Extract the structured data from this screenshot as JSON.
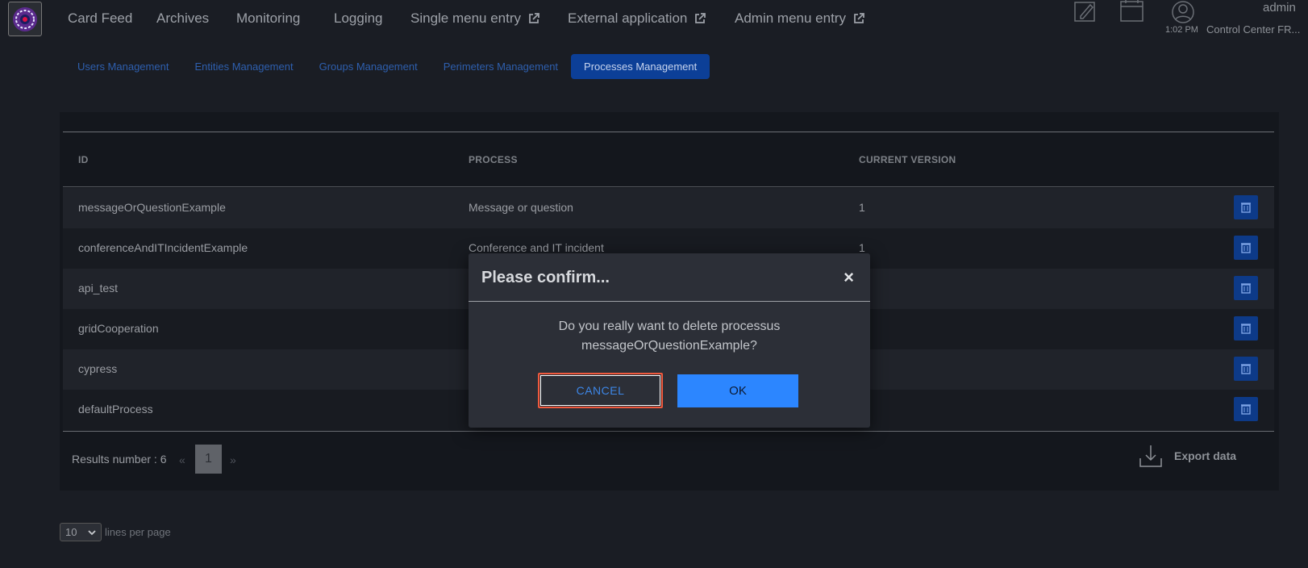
{
  "header": {
    "nav": [
      "Card Feed",
      "Archives",
      "Monitoring",
      "Logging",
      "Single menu entry",
      "External application",
      "Admin menu entry"
    ],
    "clock": "1:02 PM",
    "user": "admin",
    "center": "Control Center FR..."
  },
  "subnav": {
    "tabs": [
      "Users Management",
      "Entities Management",
      "Groups Management",
      "Perimeters Management",
      "Processes Management"
    ],
    "active": "Processes Management"
  },
  "table": {
    "columns": [
      "ID",
      "PROCESS",
      "CURRENT VERSION"
    ],
    "rows": [
      {
        "id": "messageOrQuestionExample",
        "process": "Message or question",
        "version": "1"
      },
      {
        "id": "conferenceAndITIncidentExample",
        "process": "Conference and IT incident",
        "version": "1"
      },
      {
        "id": "api_test",
        "process": "",
        "version": ""
      },
      {
        "id": "gridCooperation",
        "process": "",
        "version": ""
      },
      {
        "id": "cypress",
        "process": "",
        "version": ""
      },
      {
        "id": "defaultProcess",
        "process": "",
        "version": ""
      }
    ]
  },
  "footer": {
    "results": "Results number : 6",
    "prev": "«",
    "page": "1",
    "next": "»",
    "export": "Export data",
    "lines_per_page_value": "10",
    "lines_per_page_label": "lines per page"
  },
  "modal": {
    "title": "Please confirm...",
    "close": "×",
    "message_line1": "Do you really want to delete processus",
    "message_line2": "messageOrQuestionExample?",
    "cancel": "CANCEL",
    "ok": "OK"
  },
  "colors": {
    "accent": "#2c86ff",
    "active_tab": "#0c3f97",
    "danger_border": "#f0593d"
  }
}
